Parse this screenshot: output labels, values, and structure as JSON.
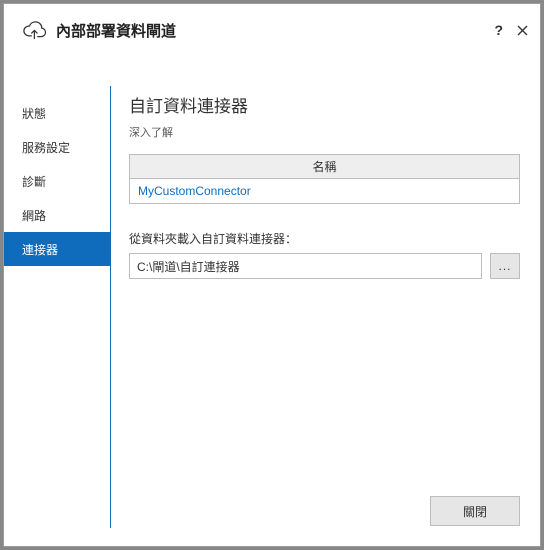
{
  "window": {
    "title": "內部部署資料閘道",
    "help_tooltip": "?",
    "close_tooltip": "✕"
  },
  "sidebar": {
    "items": [
      {
        "label": "狀態"
      },
      {
        "label": "服務設定"
      },
      {
        "label": "診斷"
      },
      {
        "label": "網路"
      },
      {
        "label": "連接器"
      }
    ],
    "selected_index": 4
  },
  "content": {
    "heading": "自訂資料連接器",
    "learn_more": "深入了解",
    "table": {
      "column_header": "名稱",
      "rows": [
        {
          "name": "MyCustomConnector"
        }
      ]
    },
    "folder_label": "從資料夾載入自訂資料連接器：",
    "folder_path": "C:\\閘道\\自訂連接器",
    "browse_label": "..."
  },
  "footer": {
    "close_label": "關閉"
  },
  "icons": {
    "cloud_upload": "cloud-upload-icon"
  }
}
